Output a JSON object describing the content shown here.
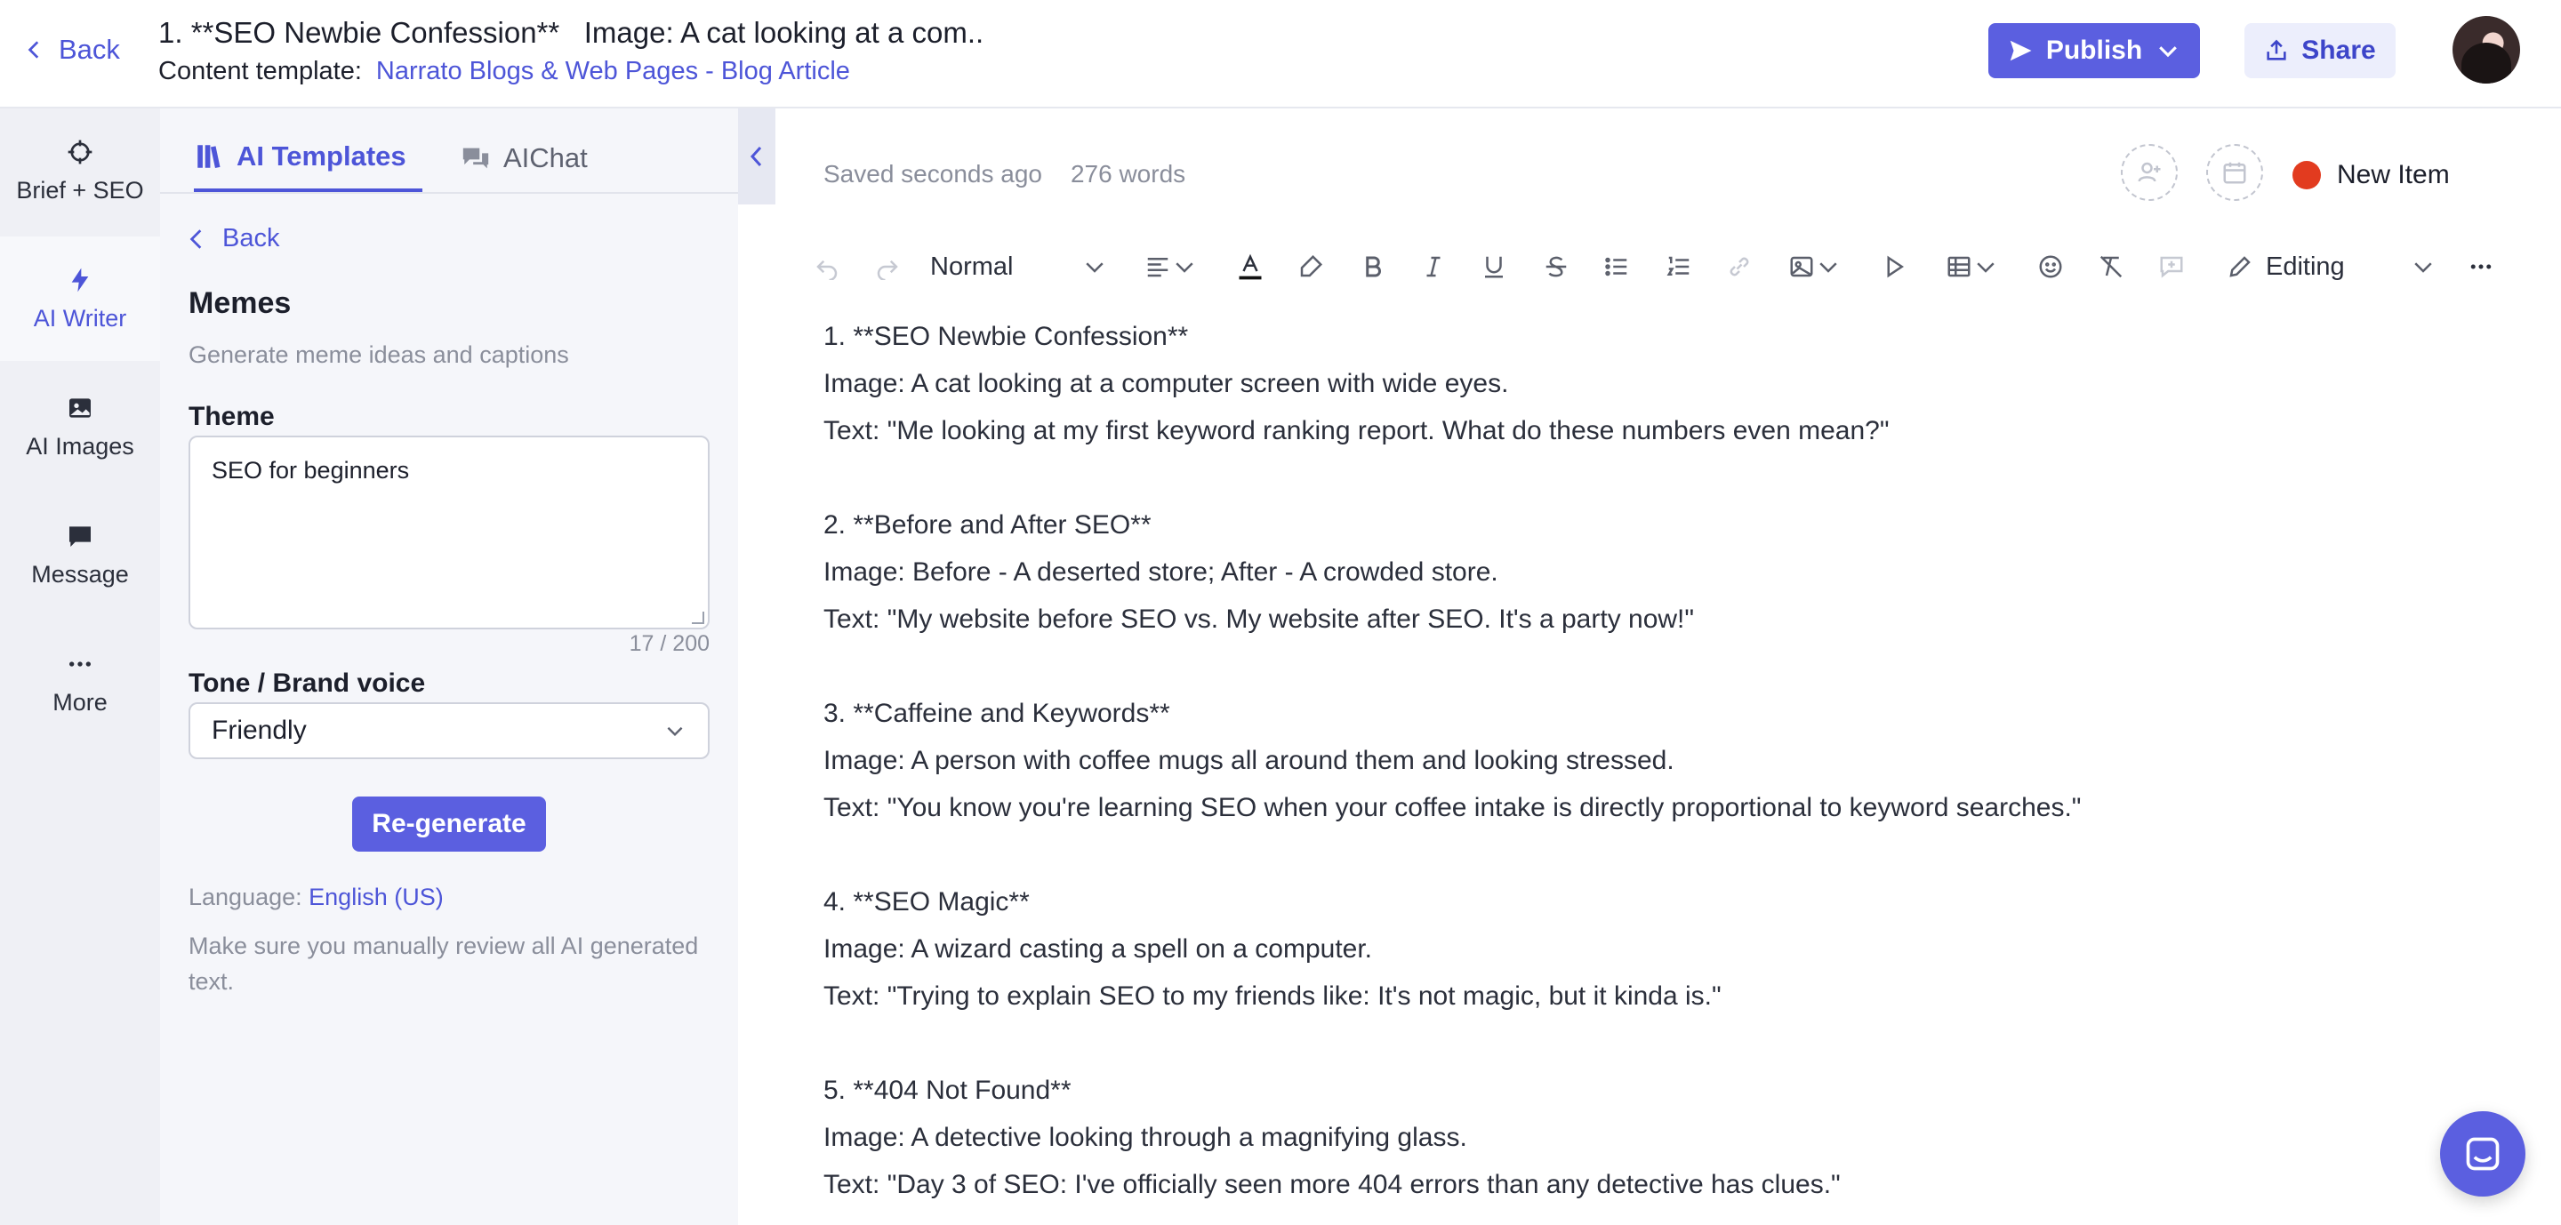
{
  "header": {
    "back_label": "Back",
    "title": "1. **SEO Newbie Confession**   Image: A cat looking at a com..",
    "template_label": "Content template:",
    "template_value": "Narrato Blogs & Web Pages - Blog Article",
    "publish_label": "Publish",
    "share_label": "Share"
  },
  "rail": {
    "items": [
      {
        "label": "Brief + SEO",
        "icon": "crosshair-icon"
      },
      {
        "label": "AI Writer",
        "icon": "lightning-icon"
      },
      {
        "label": "AI Images",
        "icon": "image-icon"
      },
      {
        "label": "Message",
        "icon": "message-icon"
      },
      {
        "label": "More",
        "icon": "more-icon"
      }
    ]
  },
  "panel": {
    "tabs": [
      {
        "label": "AI Templates",
        "icon": "templates-icon"
      },
      {
        "label": "AIChat",
        "icon": "chat-icon"
      }
    ],
    "back_label": "Back",
    "title": "Memes",
    "subtitle": "Generate meme ideas and captions",
    "theme_label": "Theme",
    "theme_value": "SEO for beginners",
    "theme_counter": "17 / 200",
    "tone_label": "Tone / Brand voice",
    "tone_value": "Friendly",
    "regenerate_label": "Re-generate",
    "language_label": "Language:",
    "language_value": "English (US)",
    "note": "Make sure you manually review all AI generated text."
  },
  "editor": {
    "saved_status": "Saved seconds ago",
    "word_count": "276 words",
    "status_label": "New Item",
    "status_color": "#e23b1f",
    "style_value": "Normal",
    "mode_value": "Editing",
    "lines": [
      "1. **SEO Newbie Confession**",
      "Image: A cat looking at a computer screen with wide eyes.",
      "Text: \"Me looking at my first keyword ranking report. What do these numbers even mean?\"",
      "",
      "2. **Before and After SEO**",
      "Image: Before - A deserted store; After - A crowded store.",
      "Text: \"My website before SEO vs. My website after SEO. It's a party now!\"",
      "",
      "3. **Caffeine and Keywords**",
      "Image: A person with coffee mugs all around them and looking stressed.",
      "Text: \"You know you're learning SEO when your coffee intake is directly proportional to keyword searches.\"",
      "",
      "4. **SEO Magic**",
      "Image: A wizard casting a spell on a computer.",
      "Text: \"Trying to explain SEO to my friends like: It's not magic, but it kinda is.\"",
      "",
      "5. **404 Not Found**",
      "Image: A detective looking through a magnifying glass.",
      "Text: \"Day 3 of SEO: I've officially seen more 404 errors than any detective has clues.\""
    ]
  },
  "colors": {
    "accent": "#5b5fe0",
    "link": "#4d55d8",
    "panel_bg": "#f5f6fa",
    "rail_bg": "#eff0f5"
  }
}
